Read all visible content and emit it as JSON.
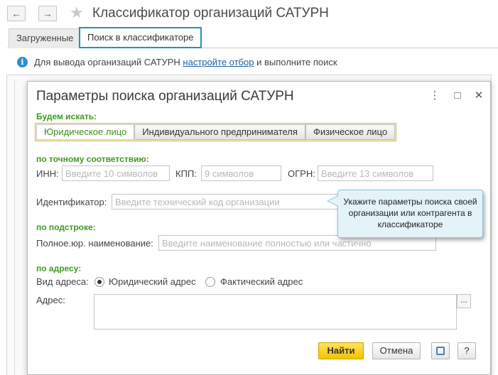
{
  "header": {
    "back_icon": "arrow-left-icon",
    "forward_icon": "arrow-right-icon",
    "star_icon": "star-icon",
    "title": "Классификатор организаций САТУРН"
  },
  "tabs": [
    {
      "label": "Загруженные"
    },
    {
      "label": "Поиск в классификаторе"
    }
  ],
  "info": {
    "icon": "info-icon",
    "prefix": "Для вывода организаций САТУРН ",
    "link": "настройте отбор",
    "suffix": " и выполните поиск"
  },
  "dialog": {
    "title": "Параметры поиска организаций САТУРН",
    "controls": {
      "more": "⋮",
      "maximize": "□",
      "close": "✕"
    },
    "search_for_label": "Будем искать:",
    "entity_types": [
      {
        "label": "Юридическое лицо",
        "active": true
      },
      {
        "label": "Индивидуального предпринимателя",
        "active": false
      },
      {
        "label": "Физическое лицо",
        "active": false
      }
    ],
    "exact_match_label": "по точному соответствию:",
    "inn": {
      "label": "ИНН:",
      "placeholder": "Введите 10 символов",
      "value": ""
    },
    "kpp": {
      "label": "КПП:",
      "placeholder": "9 символов",
      "value": ""
    },
    "ogrn": {
      "label": "ОГРН:",
      "placeholder": "Введите 13 символов",
      "value": ""
    },
    "identifier": {
      "label": "Идентификатор:",
      "placeholder": "Введите технический код организации",
      "value": ""
    },
    "substring_label": "по подстроке:",
    "full_name": {
      "label": "Полное.юр. наименование:",
      "placeholder": "Введите наименование полностью или частично",
      "value": ""
    },
    "address_section_label": "по адресу:",
    "address_type": {
      "label": "Вид адреса:",
      "options": [
        {
          "label": "Юридический адрес",
          "selected": true
        },
        {
          "label": "Фактический адрес",
          "selected": false
        }
      ]
    },
    "address": {
      "label": "Адрес:",
      "value": "",
      "select_button": "..."
    },
    "buttons": {
      "find": "Найти",
      "cancel": "Отмена",
      "settings_icon": "settings-icon",
      "help": "?"
    }
  },
  "tooltip": {
    "text": "Укажите параметры поиска своей организации или контрагента в классификаторе"
  },
  "colors": {
    "accent_green": "#3f9a1e",
    "tab_highlight": "#1f95b6",
    "primary_button": "#f3c300",
    "link": "#1a5fa6"
  }
}
